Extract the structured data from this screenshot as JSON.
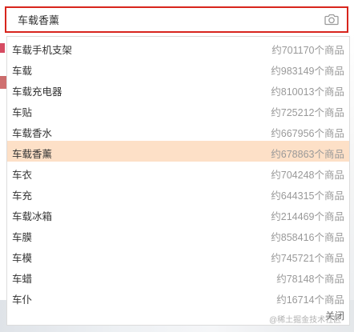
{
  "search": {
    "value": "车载香薰",
    "placeholder": ""
  },
  "colors": {
    "accent": "#d8251d",
    "highlight": "#fde0c7",
    "muted_text": "#999999"
  },
  "suggestions": [
    {
      "term": "车载手机支架",
      "count": "约701170个商品"
    },
    {
      "term": "车载",
      "count": "约983149个商品"
    },
    {
      "term": "车载充电器",
      "count": "约810013个商品"
    },
    {
      "term": "车贴",
      "count": "约725212个商品"
    },
    {
      "term": "车载香水",
      "count": "约667956个商品"
    },
    {
      "term": "车载香薰",
      "count": "约678863个商品",
      "highlighted": true
    },
    {
      "term": "车衣",
      "count": "约704248个商品"
    },
    {
      "term": "车充",
      "count": "约644315个商品"
    },
    {
      "term": "车载冰箱",
      "count": "约214469个商品"
    },
    {
      "term": "车膜",
      "count": "约858416个商品"
    },
    {
      "term": "车模",
      "count": "约745721个商品"
    },
    {
      "term": "车蜡",
      "count": "约78148个商品"
    },
    {
      "term": "车仆",
      "count": "约16714个商品"
    }
  ],
  "dropdown": {
    "close_label": "关闭"
  },
  "watermark": "@稀土掘金技术社区",
  "icons": {
    "camera": "camera-icon"
  }
}
